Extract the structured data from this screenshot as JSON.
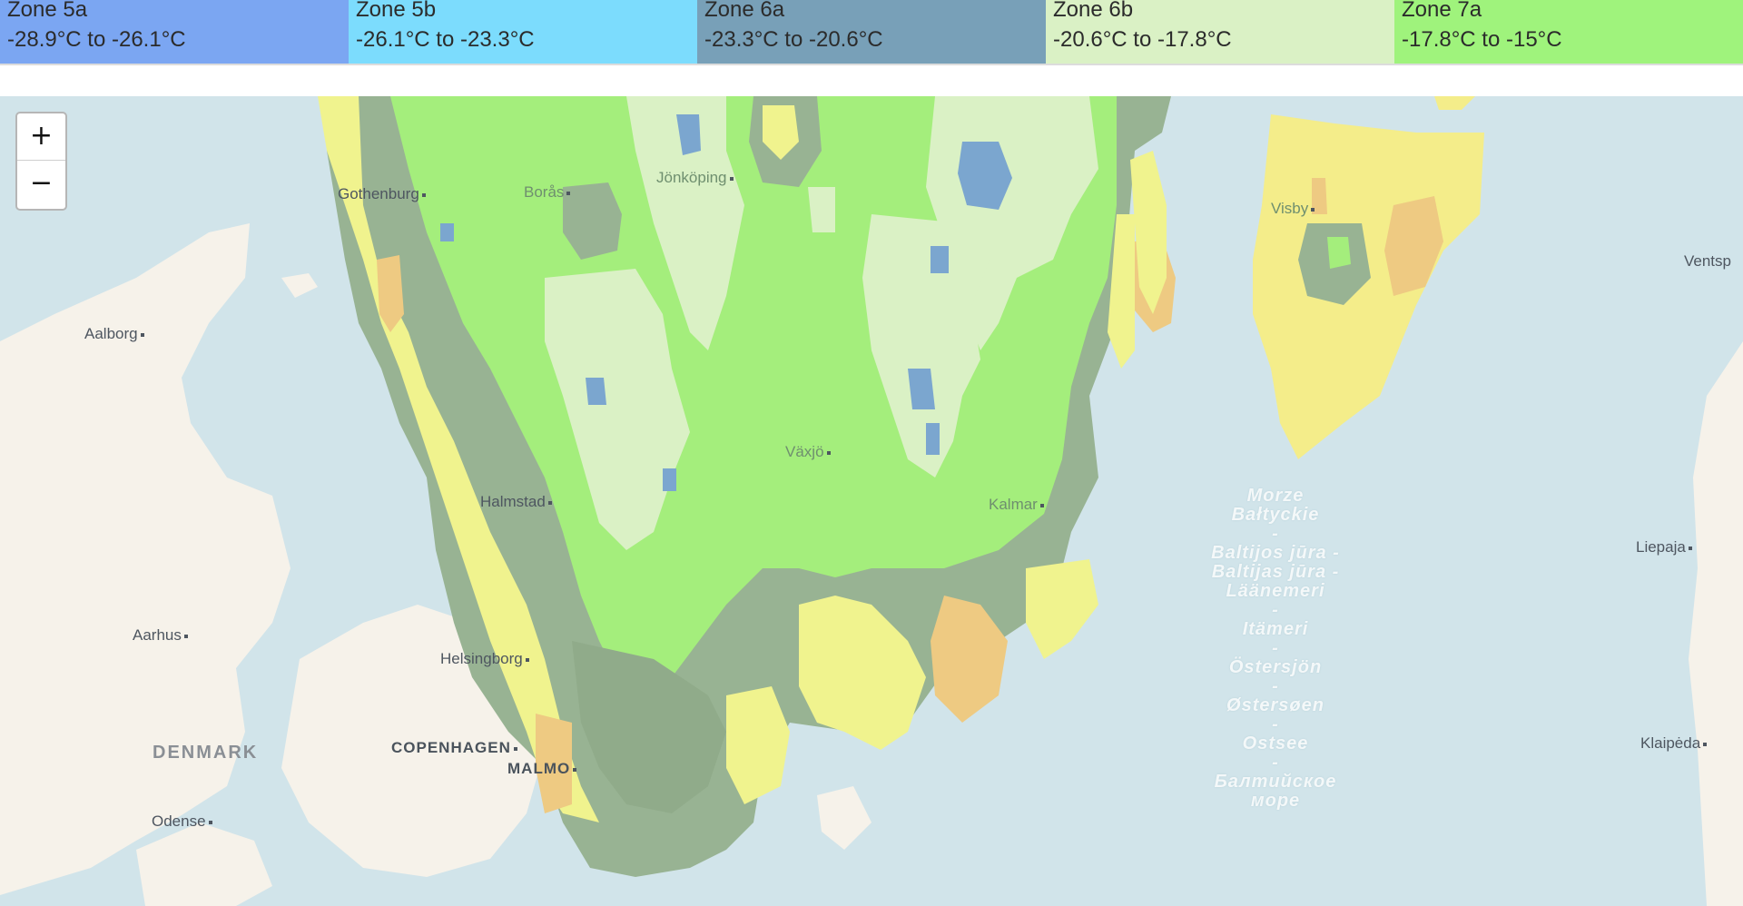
{
  "legend": {
    "zones": [
      {
        "name": "Zone 5a",
        "range": "-28.9°C to -26.1°C",
        "color": "#7ba6f2"
      },
      {
        "name": "Zone 5b",
        "range": "-26.1°C to -23.3°C",
        "color": "#7cdcfd"
      },
      {
        "name": "Zone 6a",
        "range": "-23.3°C to -20.6°C",
        "color": "#78a0b8"
      },
      {
        "name": "Zone 6b",
        "range": "-20.6°C to -17.8°C",
        "color": "#daf1c5"
      },
      {
        "name": "Zone 7a",
        "range": "-17.8°C to -15°C",
        "color": "#9ff37c"
      }
    ]
  },
  "map": {
    "zoom_in_label": "+",
    "zoom_out_label": "−",
    "cities": {
      "gothenburg": "Gothenburg",
      "boras": "Borås",
      "jonkoping": "Jönköping",
      "visby": "Visby",
      "ventspils": "Ventsp",
      "aalborg": "Aalborg",
      "vaxjo": "Växjö",
      "halmstad": "Halmstad",
      "kalmar": "Kalmar",
      "liepaja": "Liepaja",
      "aarhus": "Aarhus",
      "helsingborg": "Helsingborg",
      "copenhagen": "COPENHAGEN",
      "malmo": "MALMO",
      "odense": "Odense",
      "klaipeda": "Klaipėda"
    },
    "country_denmark": "DENMARK",
    "sea_names": [
      "Morze Bałtyckie",
      "-",
      "Baltijos jūra -",
      "Baltijas jūra -",
      "Läänemeri",
      "-",
      "Itämeri",
      "-",
      "Östersjön",
      "-",
      "Østersøen",
      "-",
      "Ostsee",
      "-",
      "Балтийское море"
    ],
    "extra_zone_colors": {
      "zone_7b": "#f4f27c",
      "zone_8a": "#f1c56e"
    }
  }
}
